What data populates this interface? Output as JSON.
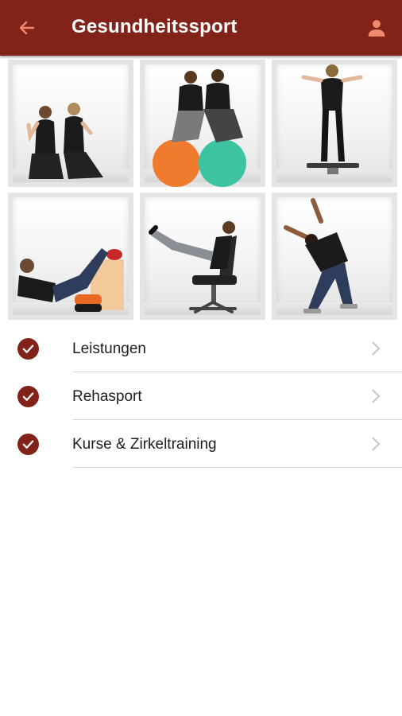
{
  "header": {
    "title": "Gesundheitssport",
    "back_icon": "arrow-left-icon",
    "profile_icon": "person-icon",
    "bar_color": "#82231a",
    "back_icon_color": "#f08a6a"
  },
  "gallery": {
    "tiles": [
      {
        "name": "photo-two-women-kneeling"
      },
      {
        "name": "photo-two-men-on-gym-balls"
      },
      {
        "name": "photo-woman-on-balance-board"
      },
      {
        "name": "photo-man-lying-with-foam-roller"
      },
      {
        "name": "photo-man-in-office-chair"
      },
      {
        "name": "photo-man-leaning-on-wall"
      }
    ]
  },
  "menu": {
    "items": [
      {
        "label": "Leistungen",
        "icon": "check-circle-icon"
      },
      {
        "label": "Rehasport",
        "icon": "check-circle-icon"
      },
      {
        "label": "Kurse & Zirkeltraining",
        "icon": "check-circle-icon"
      }
    ],
    "accent": "#82231a"
  }
}
